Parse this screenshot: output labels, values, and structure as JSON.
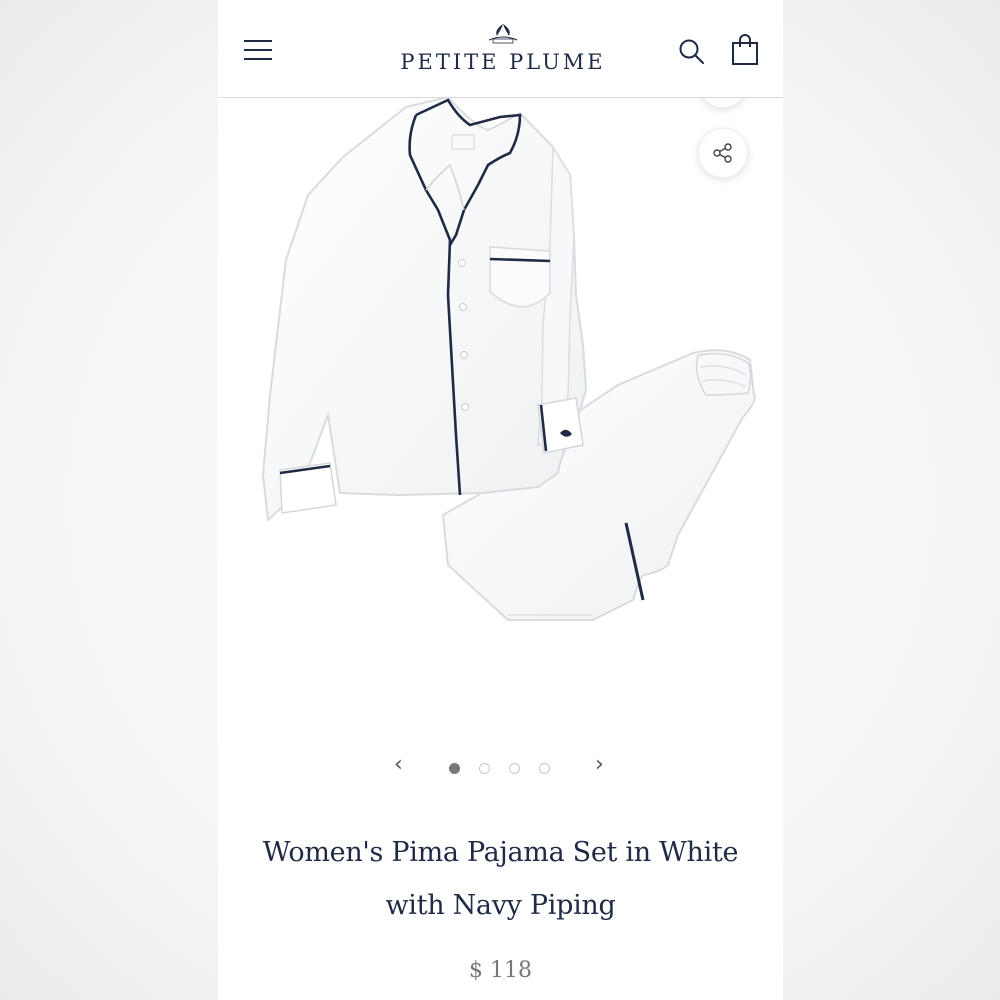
{
  "brand": {
    "name": "PETITE PLUME",
    "navy": "#1f2a44"
  },
  "header": {
    "menu_icon": "hamburger-menu-icon",
    "search_icon": "search-icon",
    "bag_icon": "shopping-bag-icon"
  },
  "gallery": {
    "share_icon": "share-icon",
    "prev_label": "‹",
    "next_label": "›",
    "total_slides": 4,
    "active_slide": 1
  },
  "product": {
    "title": "Women's Pima Pajama Set in White with Navy Piping",
    "price": "$ 118"
  }
}
